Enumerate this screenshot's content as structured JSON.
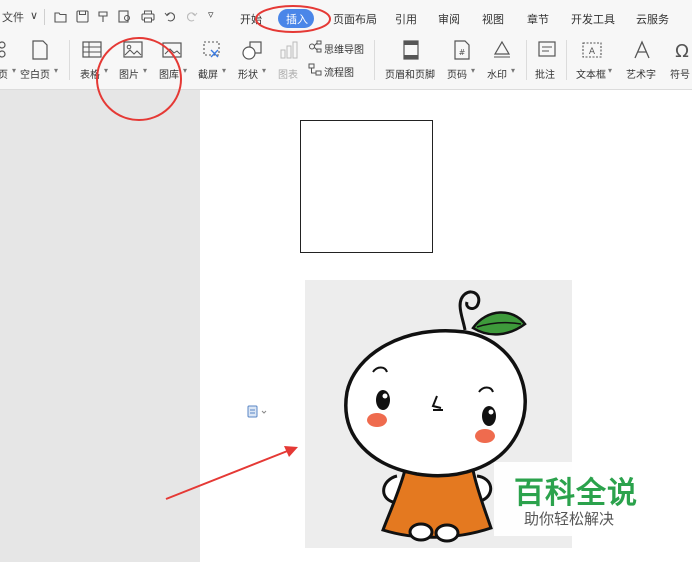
{
  "menubar": {
    "file_label": "文件",
    "tabs": [
      {
        "key": "start",
        "label": "开始"
      },
      {
        "key": "insert",
        "label": "插入"
      },
      {
        "key": "layout",
        "label": "页面布局"
      },
      {
        "key": "ref",
        "label": "引用"
      },
      {
        "key": "review",
        "label": "审阅"
      },
      {
        "key": "view",
        "label": "视图"
      },
      {
        "key": "section",
        "label": "章节"
      },
      {
        "key": "dev",
        "label": "开发工具"
      },
      {
        "key": "cloud",
        "label": "云服务"
      }
    ],
    "active_tab": "插入"
  },
  "ribbon": {
    "items": {
      "cover": "页",
      "blank": "空白页",
      "table": "表格",
      "picture": "图片",
      "gallery": "图库",
      "screenshot": "截屏",
      "shape": "形状",
      "chart": "图表",
      "mindmap": "思维导图",
      "flowchart": "流程图",
      "header_footer": "页眉和页脚",
      "page_number": "页码",
      "watermark": "水印",
      "comment": "批注",
      "textbox": "文本框",
      "wordart": "艺术字",
      "symbol": "符号"
    }
  },
  "watermark": {
    "title": "百科全说",
    "subtitle": "助你轻松解决"
  },
  "colors": {
    "active_tab": "#4a86e8",
    "annotation": "#e53935",
    "watermark_green": "#2ba24c"
  }
}
